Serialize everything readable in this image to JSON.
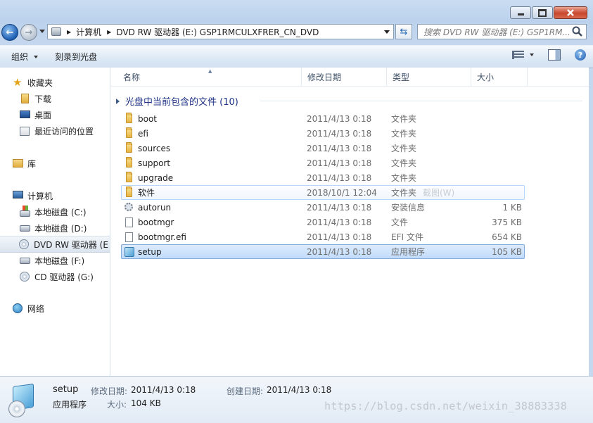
{
  "window": {
    "controls": {
      "minimize": "minimize-icon",
      "maximize": "maximize-icon",
      "close": "close-icon"
    }
  },
  "address_bar": {
    "crumbs": [
      "计算机",
      "DVD RW 驱动器 (E:) GSP1RMCULXFRER_CN_DVD"
    ]
  },
  "search": {
    "placeholder": "搜索 DVD RW 驱动器 (E:) GSP1RM..."
  },
  "toolbar": {
    "organize_label": "组织",
    "burn_label": "刻录到光盘"
  },
  "nav_pane": {
    "favorites": {
      "label": "收藏夹",
      "items": [
        "下载",
        "桌面",
        "最近访问的位置"
      ]
    },
    "libraries": {
      "label": "库"
    },
    "computer": {
      "label": "计算机",
      "items": [
        "本地磁盘 (C:)",
        "本地磁盘 (D:)",
        "DVD RW 驱动器 (E",
        "本地磁盘 (F:)",
        "CD 驱动器 (G:)"
      ],
      "selected_index": 2
    },
    "network": {
      "label": "网络"
    }
  },
  "columns": {
    "name": "名称",
    "modified": "修改日期",
    "type": "类型",
    "size": "大小"
  },
  "group_header": "光盘中当前包含的文件 (10)",
  "files": [
    {
      "name": "boot",
      "modified": "2011/4/13 0:18",
      "type": "文件夹",
      "size": "",
      "icon": "folder-icon"
    },
    {
      "name": "efi",
      "modified": "2011/4/13 0:18",
      "type": "文件夹",
      "size": "",
      "icon": "folder-icon"
    },
    {
      "name": "sources",
      "modified": "2011/4/13 0:18",
      "type": "文件夹",
      "size": "",
      "icon": "folder-icon"
    },
    {
      "name": "support",
      "modified": "2011/4/13 0:18",
      "type": "文件夹",
      "size": "",
      "icon": "folder-icon"
    },
    {
      "name": "upgrade",
      "modified": "2011/4/13 0:18",
      "type": "文件夹",
      "size": "",
      "icon": "folder-icon"
    },
    {
      "name": "软件",
      "modified": "2018/10/1 12:04",
      "type": "文件夹",
      "size": "",
      "icon": "folder-icon",
      "ghost": "截图(W)"
    },
    {
      "name": "autorun",
      "modified": "2011/4/13 0:18",
      "type": "安装信息",
      "size": "1 KB",
      "icon": "settings-file-icon"
    },
    {
      "name": "bootmgr",
      "modified": "2011/4/13 0:18",
      "type": "文件",
      "size": "375 KB",
      "icon": "file-icon"
    },
    {
      "name": "bootmgr.efi",
      "modified": "2011/4/13 0:18",
      "type": "EFI 文件",
      "size": "654 KB",
      "icon": "file-icon"
    },
    {
      "name": "setup",
      "modified": "2011/4/13 0:18",
      "type": "应用程序",
      "size": "105 KB",
      "icon": "setup-app-icon"
    }
  ],
  "selected_file_index": 9,
  "hover_file_index": 5,
  "details": {
    "name": "setup",
    "type": "应用程序",
    "modified_label": "修改日期:",
    "modified_value": "2011/4/13 0:18",
    "created_label": "创建日期:",
    "created_value": "2011/4/13 0:18",
    "size_label": "大小:",
    "size_value": "104 KB"
  },
  "watermark": "https://blog.csdn.net/weixin_38883338"
}
